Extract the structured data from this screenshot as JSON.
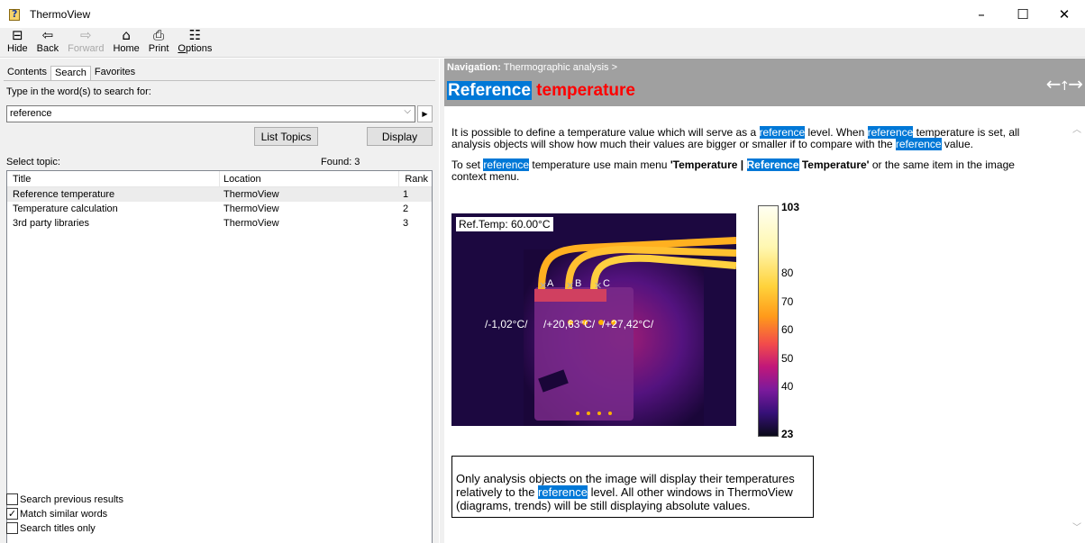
{
  "window": {
    "title": "ThermoView",
    "minimize_glyph": "–",
    "maximize_glyph": "☐",
    "close_glyph": "✕"
  },
  "toolbar": {
    "hide": "Hide",
    "back": "Back",
    "forward": "Forward",
    "home": "Home",
    "print": "Print",
    "options": "Options"
  },
  "tabs": [
    "Contents",
    "Search",
    "Favorites"
  ],
  "search": {
    "hint": "Type in the word(s) to search for:",
    "query": "reference",
    "list_topics_label": "List Topics",
    "display_label": "Display",
    "select_topic_label": "Select topic:",
    "found_label": "Found: 3"
  },
  "results": {
    "columns": [
      "Title",
      "Location",
      "Rank"
    ],
    "rows": [
      {
        "title": "Reference temperature",
        "location": "ThermoView",
        "rank": "1"
      },
      {
        "title": "Temperature calculation",
        "location": "ThermoView",
        "rank": "2"
      },
      {
        "title": "3rd party libraries",
        "location": "ThermoView",
        "rank": "3"
      }
    ]
  },
  "options": {
    "search_previous": "Search previous results",
    "search_previous_checked": false,
    "match_similar": "Match similar words",
    "match_similar_checked": true,
    "titles_only": "Search titles only",
    "titles_only_checked": false
  },
  "topic": {
    "nav_prefix": "Navigation:",
    "nav_path": "Thermographic analysis >",
    "title_highlight": "Reference",
    "title_rest": "temperature",
    "p1": {
      "a": "It is possible to define a temperature value which will serve as a ",
      "h1": "reference",
      "b": " level. When ",
      "h2": "reference",
      "c": " temperature is set, all analysis objects will show how much their values are bigger or smaller if to compare with the ",
      "h3": "reference",
      "d": " value."
    },
    "p2": {
      "a": "To set ",
      "h1": "reference",
      "b": " temperature use main menu ",
      "bold1": "'Temperature | ",
      "h2": "Reference",
      "bold2": " Temperature'",
      "c": " or the same item in the image context menu."
    },
    "image": {
      "ref_temp": "Ref.Temp: 60.00°C",
      "point_a": "A",
      "point_b": "B",
      "point_c": "C",
      "delta_a": "/-1,02°C/",
      "delta_b": "/+20,63°C/",
      "delta_c": "/+27,42°C/"
    },
    "colorbar": {
      "max": "103",
      "min": "23",
      "ticks": [
        "80",
        "70",
        "60",
        "50",
        "40"
      ]
    },
    "note": {
      "a": "Only analysis objects on the image will display their temperatures relatively to the ",
      "h": "reference",
      "b": " level. All other windows in ThermoView (diagrams, trends) will be still displaying absolute values."
    }
  }
}
